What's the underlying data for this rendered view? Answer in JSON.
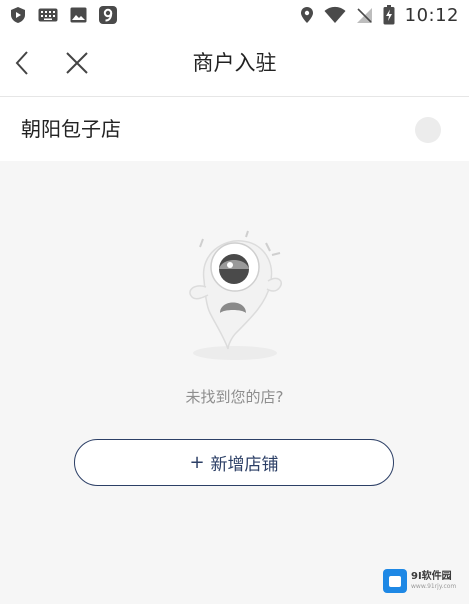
{
  "status_bar": {
    "time": "10:12",
    "left_icons": [
      "shield-play-icon",
      "keyboard-icon",
      "image-icon",
      "app-9-icon"
    ],
    "right_icons": [
      "location-pin-icon",
      "wifi-icon",
      "no-signal-icon",
      "battery-charging-icon"
    ]
  },
  "nav": {
    "title": "商户入驻",
    "back_icon": "chevron-left-icon",
    "close_icon": "close-icon"
  },
  "store": {
    "name": "朝阳包子店"
  },
  "empty_state": {
    "message": "未找到您的店?"
  },
  "actions": {
    "add_store_plus": "+",
    "add_store_label": "新增店铺"
  },
  "watermark": {
    "brand": "9I软件园",
    "site": "www.91rjy.com"
  },
  "colors": {
    "accent": "#2c3f66",
    "background": "#f6f6f6",
    "muted_text": "#8e8e8e"
  }
}
